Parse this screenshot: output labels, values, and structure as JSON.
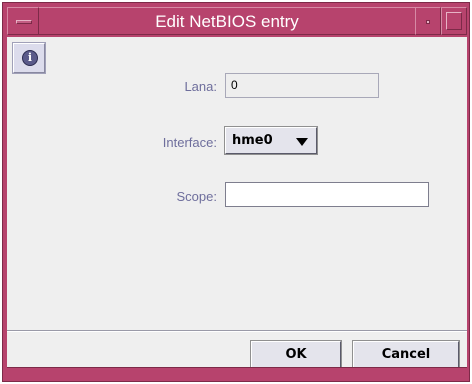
{
  "window": {
    "title": "Edit NetBIOS entry"
  },
  "form": {
    "lana_label": "Lana:",
    "lana_value": "0",
    "interface_label": "Interface:",
    "interface_value": "hme0",
    "scope_label": "Scope:",
    "scope_value": ""
  },
  "buttons": {
    "ok": "OK",
    "cancel": "Cancel"
  },
  "icons": {
    "info": "info-icon",
    "dropdown": "caret-down-icon"
  },
  "colors": {
    "title_bar": "#b7436d",
    "client_bg": "#efefef",
    "label_text": "#6e6e9c"
  }
}
